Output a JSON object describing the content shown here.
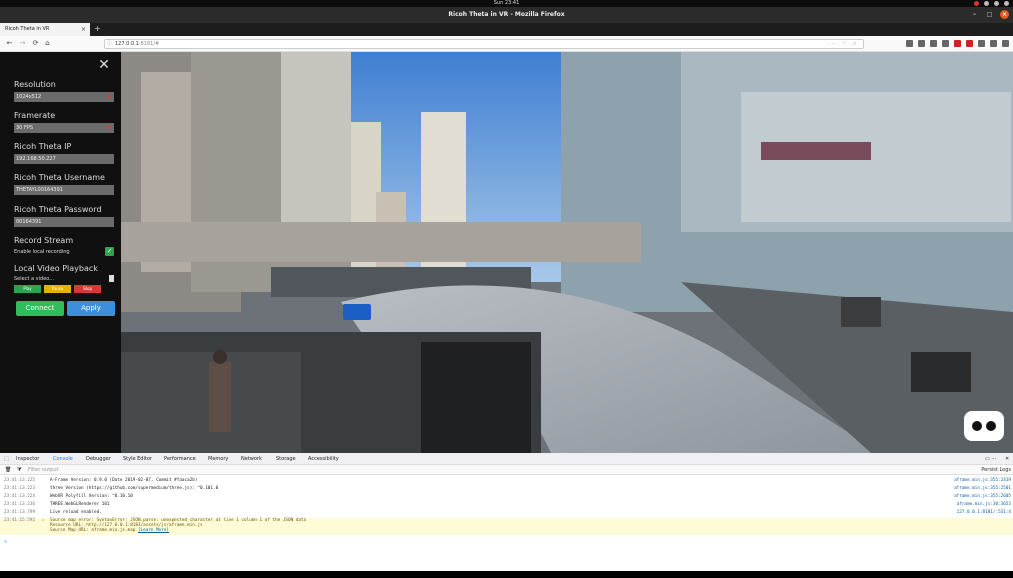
{
  "os": {
    "clock": "Sun 23:41"
  },
  "window": {
    "title": "Ricoh Theta in VR - Mozilla Firefox",
    "min": "–",
    "max": "□",
    "close": "×"
  },
  "tab": {
    "title": "Ricoh Theta in VR",
    "close": "×",
    "new_tab": "+"
  },
  "nav": {
    "back": "←",
    "forward": "→",
    "reload": "⟳",
    "home": "⌂",
    "url_host": "127.0.0.1",
    "url_path": ":8181/#",
    "actions": "··· ♡ ☆"
  },
  "panel": {
    "close": "✕",
    "resolution_label": "Resolution",
    "resolution_value": "1024x512",
    "framerate_label": "Framerate",
    "framerate_value": "30 FPS",
    "ip_label": "Ricoh Theta IP",
    "ip_value": "192.168.50.227",
    "username_label": "Ricoh Theta Username",
    "username_value": "THETAYL00164391",
    "password_label": "Ricoh Theta Password",
    "password_value": "00164391",
    "record_label": "Record Stream",
    "record_checkbox_label": "Enable local recording",
    "record_checked": "✓",
    "playback_label": "Local Video Playback",
    "select_video": "Select a video...",
    "play": "Play",
    "pause": "Pause",
    "stop": "Stop",
    "connect": "Connect",
    "apply": "Apply"
  },
  "devtools": {
    "tabs": [
      "Inspector",
      "Console",
      "Debugger",
      "Style Editor",
      "Performance",
      "Memory",
      "Network",
      "Storage",
      "Accessibility"
    ],
    "filter_placeholder": "Filter output",
    "persist_logs": "Persist Logs",
    "logs": [
      {
        "ts": "23:41:13.225",
        "msg": "A-Frame Version: 0.9.0 (Date 2019-02-07, Commit #faaca2b)",
        "src": "aframe.min.js:355:2419"
      },
      {
        "ts": "23:41:13.223",
        "msg": "three Version (https://github.com/supermedium/three.js): ^0.101.0",
        "src": "aframe.min.js:355:2501"
      },
      {
        "ts": "23:41:13.224",
        "msg": "WebVR Polyfill Version: ^0.10.10",
        "src": "aframe.min.js:355:2605"
      },
      {
        "ts": "23:41:13.236",
        "msg": "THREE.WebGLRenderer 101",
        "src": "aframe.min.js:30:3653"
      },
      {
        "ts": "23:41:13.799",
        "msg": "Live reload enabled.",
        "src": "127.0.0.1:8181/:531:4"
      }
    ],
    "warning": {
      "ts": "23:41:15.592",
      "line1": "Source map error: SyntaxError: JSON.parse: unexpected character at line 1 column 1 of the JSON data",
      "line2": "Resource URL: http://127.0.0.1:8181/assets/js/aframe.min.js",
      "line3": "Source Map URL: aframe.min.js.map",
      "learn_more": "[Learn More]"
    },
    "prompt": "»"
  },
  "colors": {
    "play": "#2ea44f",
    "pause": "#e0b400",
    "stop": "#d93838",
    "connect": "#2ebd59",
    "apply": "#3d8fdb"
  }
}
